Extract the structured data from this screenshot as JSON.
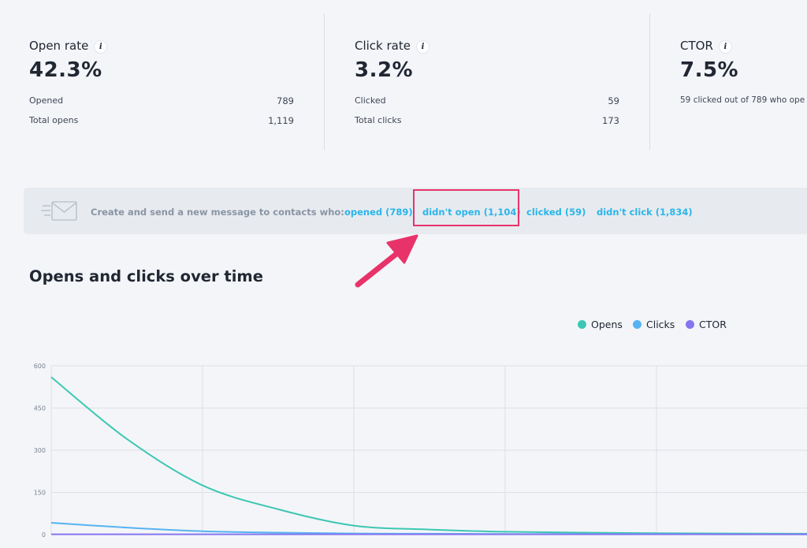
{
  "stats": [
    {
      "title": "Open rate",
      "value": "42.3%",
      "rows": [
        {
          "label": "Opened",
          "value": "789"
        },
        {
          "label": "Total opens",
          "value": "1,119"
        }
      ]
    },
    {
      "title": "Click rate",
      "value": "3.2%",
      "rows": [
        {
          "label": "Clicked",
          "value": "59"
        },
        {
          "label": "Total clicks",
          "value": "173"
        }
      ]
    },
    {
      "title": "CTOR",
      "value": "7.5%",
      "sub": "59 clicked out of 789 who ope"
    }
  ],
  "banner": {
    "icon": "envelope-icon",
    "text": "Create and send a new message to contacts who:",
    "links": [
      {
        "label": "opened (789)"
      },
      {
        "label": "didn't open (1,104)",
        "highlighted": true
      },
      {
        "label": "clicked (59)"
      },
      {
        "label": "didn't click (1,834)"
      }
    ]
  },
  "annotation": {
    "arrow_color": "#e8336a"
  },
  "section_title": "Opens and clicks over time",
  "legend": [
    {
      "name": "Opens",
      "color": "#3cc7b4"
    },
    {
      "name": "Clicks",
      "color": "#56b3f2"
    },
    {
      "name": "CTOR",
      "color": "#8575f0"
    }
  ],
  "chart_data": {
    "type": "line",
    "title": "Opens and clicks over time",
    "xlabel": "",
    "ylabel": "",
    "ylim": [
      0,
      600
    ],
    "yticks": [
      "600",
      "450",
      "300",
      "150",
      "0"
    ],
    "grid": true,
    "legend_position": "top-right",
    "x": [
      0,
      0.5,
      1,
      1.5,
      2,
      2.5,
      3,
      3.5,
      4,
      4.5,
      5
    ],
    "series": [
      {
        "name": "Opens",
        "color": "#3cc7b4",
        "values": [
          560,
          340,
          175,
          90,
          32,
          18,
          10,
          7,
          5,
          4,
          3
        ]
      },
      {
        "name": "Clicks",
        "color": "#56b3f2",
        "values": [
          42,
          25,
          12,
          7,
          4,
          3,
          2,
          2,
          2,
          1,
          1
        ]
      },
      {
        "name": "CTOR",
        "color": "#8575f0",
        "values": [
          1,
          1,
          1,
          1,
          1,
          1,
          1,
          1,
          1,
          1,
          1
        ]
      }
    ]
  }
}
